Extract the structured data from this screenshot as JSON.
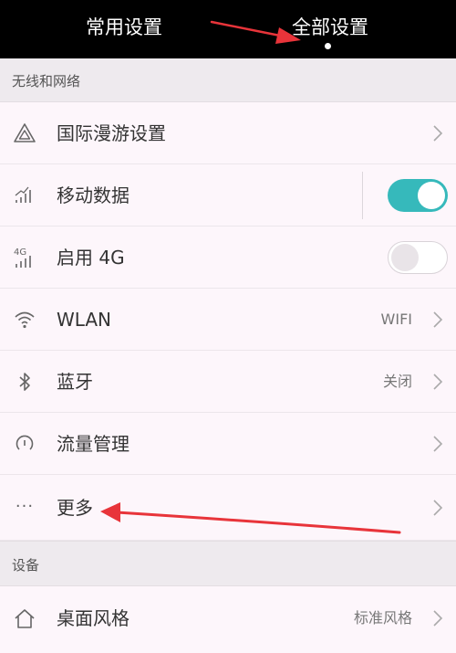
{
  "tabs": {
    "common": "常用设置",
    "all": "全部设置"
  },
  "sections": {
    "wireless": "无线和网络",
    "device": "设备"
  },
  "rows": [
    {
      "label": "国际漫游设置",
      "icon": "triangle-icon"
    },
    {
      "label": "移动数据",
      "icon": "signal-icon",
      "toggle": true
    },
    {
      "label": "启用 4G",
      "icon": "4g-signal-icon",
      "icon_text": "4G",
      "toggle": false
    },
    {
      "label": "WLAN",
      "icon": "wifi-icon",
      "value": "WIFI"
    },
    {
      "label": "蓝牙",
      "icon": "bluetooth-icon",
      "value": "关闭"
    },
    {
      "label": "流量管理",
      "icon": "data-usage-icon"
    },
    {
      "label": "更多",
      "icon": "more-dots-icon",
      "icon_text": "···"
    },
    {
      "label": "桌面风格",
      "icon": "home-icon",
      "value": "标准风格"
    }
  ],
  "colors": {
    "toggle_on": "#36b9bb",
    "annotation_arrow": "#e8343a",
    "background": "#fdf6fb",
    "section_bg": "#eeeaee"
  }
}
